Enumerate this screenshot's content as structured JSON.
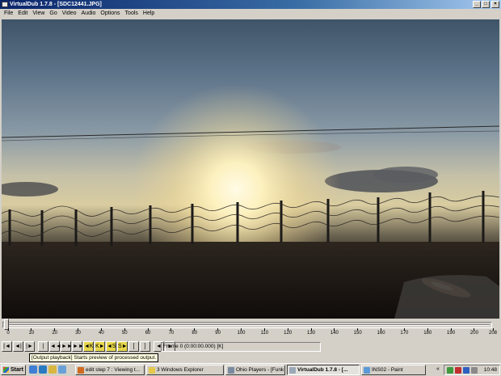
{
  "window": {
    "title": "VirtualDub 1.7.8 - [SDC12441.JPG]"
  },
  "window_buttons": {
    "minimize": "_",
    "maximize": "□",
    "close": "×"
  },
  "menu": [
    "File",
    "Edit",
    "View",
    "Go",
    "Video",
    "Audio",
    "Options",
    "Tools",
    "Help"
  ],
  "timeline": {
    "ticks": [
      "0",
      "10",
      "20",
      "30",
      "40",
      "50",
      "60",
      "70",
      "80",
      "90",
      "100",
      "110",
      "120",
      "130",
      "140",
      "150",
      "160",
      "170",
      "180",
      "190",
      "200",
      "208"
    ],
    "position": 0
  },
  "toolbar": {
    "buttons": [
      "|◄",
      "◄|",
      "|►",
      "|◄◄",
      "◄◄",
      "►►",
      "►►|",
      "◄K",
      "K►",
      "◄S",
      "S►",
      "[",
      "]",
      "◄",
      "►"
    ],
    "frame_info": "Frame 0 (0:00:00.000) [K]"
  },
  "status": {
    "text": "[Output playback] Starts preview of processed output."
  },
  "taskbar": {
    "start_label": "Start",
    "tasks": [
      {
        "label": "edit step 7 : Viewing t...",
        "icon": "browser-icon",
        "color": "#d06a20"
      },
      {
        "label": "3 Windows Explorer",
        "icon": "folder-icon",
        "color": "#e6c84a"
      },
      {
        "label": "Ohio Players - [Funk ...",
        "icon": "media-icon",
        "color": "#7a8aa0"
      },
      {
        "label": "VirtualDub 1.7.8 - [...",
        "icon": "vdub-icon",
        "color": "#9aa8b8",
        "active": true
      },
      {
        "label": "INS02 - Paint",
        "icon": "paint-icon",
        "color": "#5a9ad6"
      }
    ],
    "tray_chevron": "«",
    "clock": "10:48"
  },
  "colors": {
    "titlebar": "#0a246a",
    "tooltip": "#ffffe1",
    "chrome": "#d4d0c8"
  }
}
